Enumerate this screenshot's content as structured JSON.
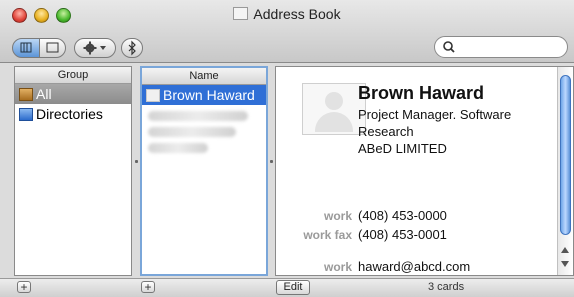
{
  "window": {
    "title": "Address Book"
  },
  "toolbar": {
    "search_placeholder": ""
  },
  "groups": {
    "header": "Group",
    "items": [
      {
        "label": "All"
      },
      {
        "label": "Directories"
      }
    ]
  },
  "names": {
    "header": "Name",
    "items": [
      {
        "label": "Brown Haward"
      }
    ]
  },
  "card": {
    "name": "Brown Haward",
    "title_line1": "Project Manager. Software",
    "title_line2": "Research",
    "company": "ABeD LIMITED",
    "fields": [
      {
        "label": "work",
        "value": "(408) 453-0000"
      },
      {
        "label": "work fax",
        "value": "(408) 453-0001"
      },
      {
        "label": "work",
        "value": "haward@abcd.com"
      }
    ]
  },
  "bottom": {
    "add_group": "+",
    "add_person": "+",
    "edit": "Edit",
    "count": "3 cards"
  }
}
